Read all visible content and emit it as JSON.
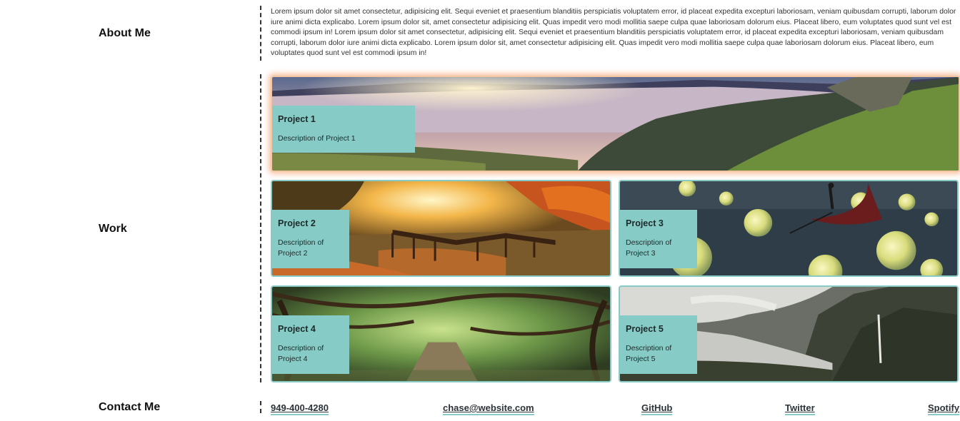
{
  "sections": {
    "about": "About Me",
    "work": "Work",
    "contact": "Contact Me"
  },
  "about": {
    "text": "Lorem ipsum dolor sit amet consectetur, adipisicing elit. Sequi eveniet et praesentium blanditiis perspiciatis voluptatem error, id placeat expedita excepturi laboriosam, veniam quibusdam corrupti, laborum dolor iure animi dicta explicabo. Lorem ipsum dolor sit, amet consectetur adipisicing elit. Quas impedit vero modi mollitia saepe culpa quae laboriosam dolorum eius. Placeat libero, eum voluptates quod sunt vel est commodi ipsum in! Lorem ipsum dolor sit amet consectetur, adipisicing elit. Sequi eveniet et praesentium blanditiis perspiciatis voluptatem error, id placeat expedita excepturi laboriosam, veniam quibusdam corrupti, laborum dolor iure animi dicta explicabo. Lorem ipsum dolor sit, amet consectetur adipisicing elit. Quas impedit vero modi mollitia saepe culpa quae laboriosam dolorum eius. Placeat libero, eum voluptates quod sunt vel est commodi ipsum in!"
  },
  "projects": [
    {
      "title": "Project 1",
      "description": "Description of Project 1",
      "image": "lake-sunset-mountains"
    },
    {
      "title": "Project 2",
      "description": "Description of Project 2",
      "image": "autumn-bridge"
    },
    {
      "title": "Project 3",
      "description": "Description of Project 3",
      "image": "glowing-orbs-boat"
    },
    {
      "title": "Project 4",
      "description": "Description of Project 4",
      "image": "tree-canopy-tunnel"
    },
    {
      "title": "Project 5",
      "description": "Description of Project 5",
      "image": "misty-mountains-waterfall"
    }
  ],
  "contact": {
    "phone": "949-400-4280",
    "email": "chase@website.com",
    "github": "GitHub",
    "twitter": "Twitter",
    "spotify": "Spotify"
  },
  "colors": {
    "accent": "#87cbc6",
    "featured_glow": "#f5a06e"
  }
}
